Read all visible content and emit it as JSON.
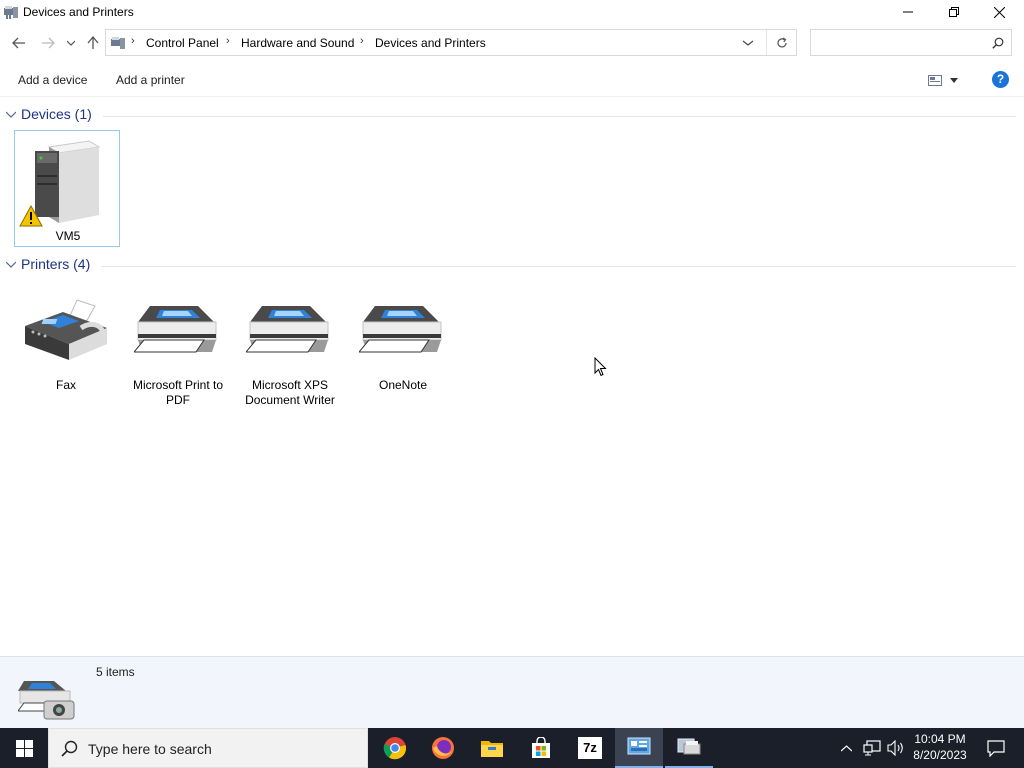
{
  "window": {
    "title": "Devices and Printers",
    "controls": {
      "minimize": "minimize-icon",
      "maximize": "restore-icon",
      "close": "close-icon"
    }
  },
  "address": {
    "breadcrumb": [
      "Control Panel",
      "Hardware and Sound",
      "Devices and Printers"
    ],
    "search_placeholder": ""
  },
  "commands": {
    "add_device": "Add a device",
    "add_printer": "Add a printer"
  },
  "groups": {
    "devices": {
      "title": "Devices (1)",
      "items": [
        {
          "label": "VM5",
          "icon": "computer-icon",
          "warning": true
        }
      ]
    },
    "printers": {
      "title": "Printers (4)",
      "items": [
        {
          "label": "Fax",
          "icon": "fax-icon"
        },
        {
          "label": "Microsoft Print to PDF",
          "icon": "printer-icon"
        },
        {
          "label": "Microsoft XPS Document Writer",
          "icon": "printer-icon"
        },
        {
          "label": "OneNote",
          "icon": "printer-icon"
        }
      ]
    }
  },
  "details": {
    "count": "5 items"
  },
  "taskbar": {
    "search_placeholder": "Type here to search",
    "apps": [
      "chrome-icon",
      "firefox-icon",
      "file-explorer-icon",
      "store-icon",
      "7zip-icon",
      "control-panel-icon",
      "devices-printers-icon"
    ],
    "seven_zip_label": "7z",
    "time": "10:04 PM",
    "date": "8/20/2023"
  },
  "colors": {
    "accent": "#1e3287",
    "taskbar": "#1b1f2a",
    "details_bg": "#f2f5fc",
    "help": "#1a73d8"
  }
}
